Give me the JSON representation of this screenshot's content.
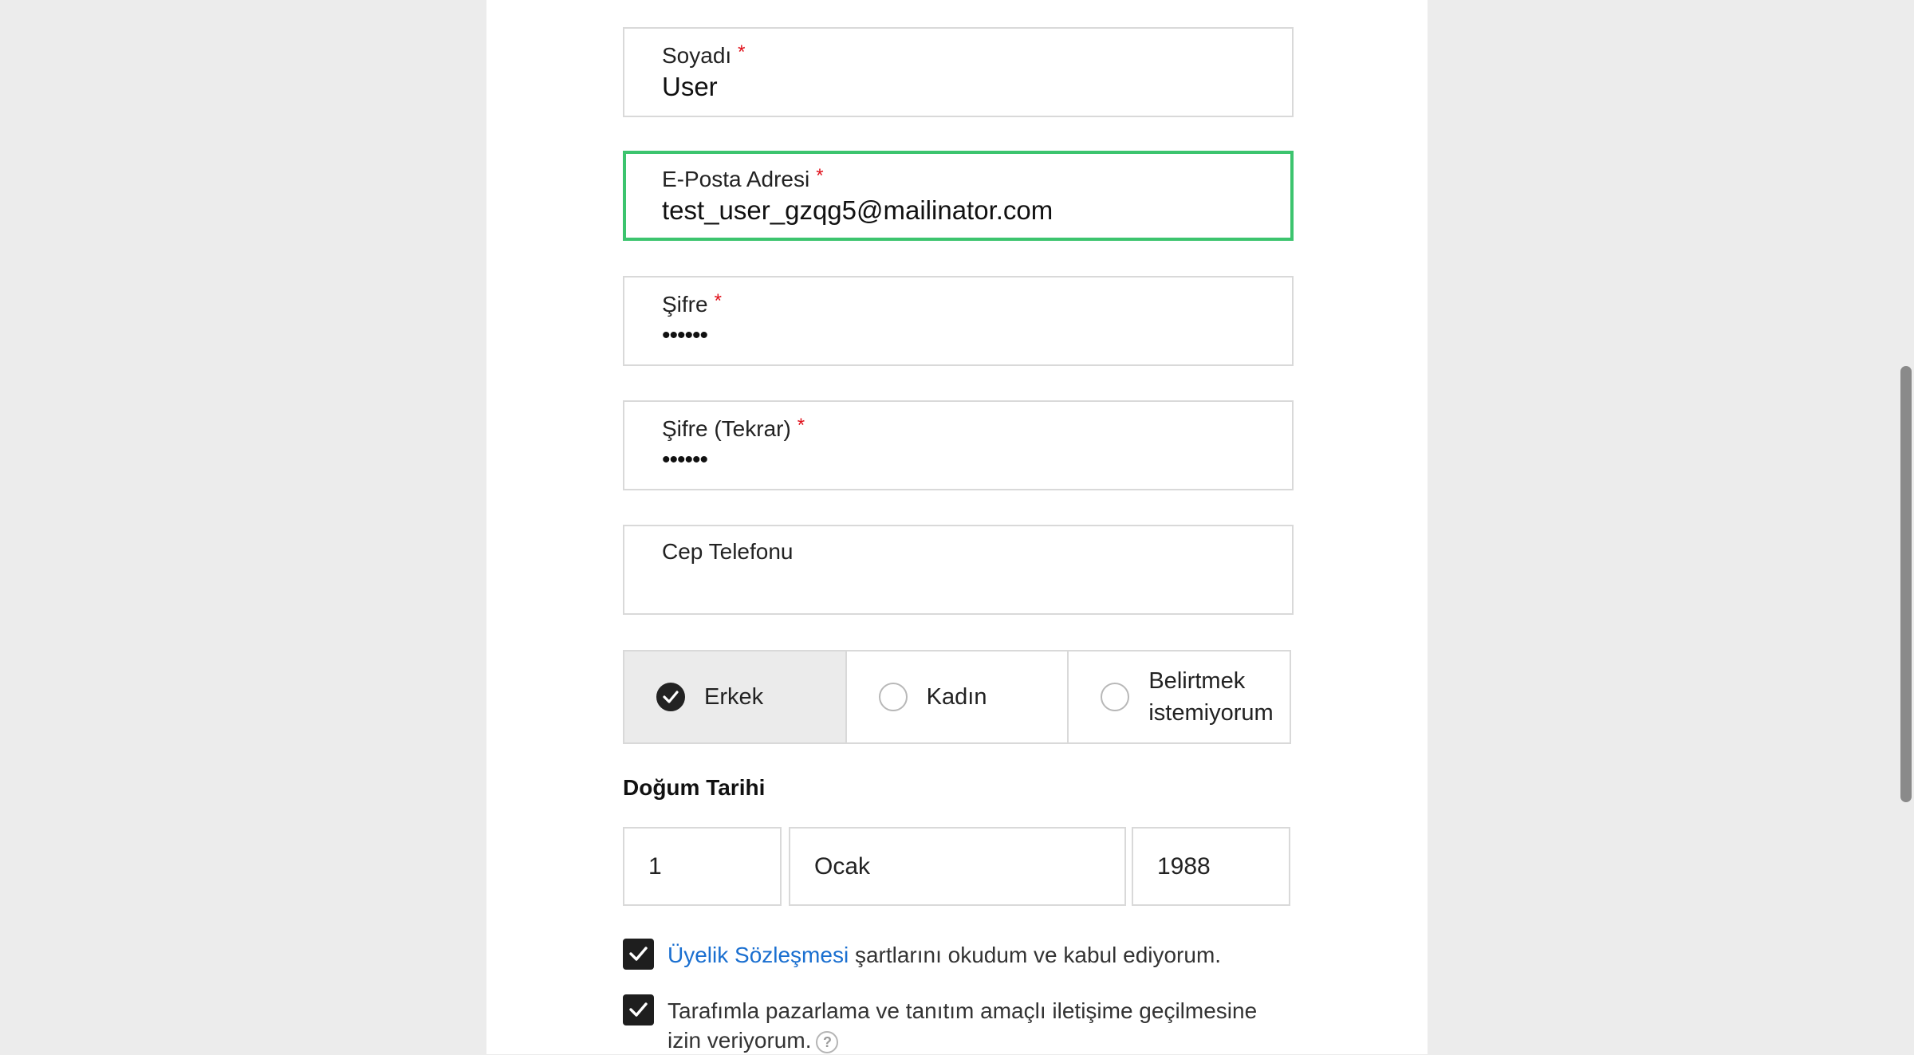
{
  "form": {
    "surname": {
      "label": "Soyadı",
      "required_mark": "*",
      "value": "User"
    },
    "email": {
      "label": "E-Posta Adresi",
      "required_mark": "*",
      "value": "test_user_gzqg5@mailinator.com"
    },
    "password": {
      "label": "Şifre",
      "required_mark": "*",
      "value": "••••••"
    },
    "password_repeat": {
      "label": "Şifre (Tekrar)",
      "required_mark": "*",
      "value": "••••••"
    },
    "phone": {
      "label": "Cep Telefonu",
      "value": ""
    },
    "gender": {
      "selected": "Erkek",
      "options": [
        {
          "label": "Erkek",
          "checked": true
        },
        {
          "label": "Kadın",
          "checked": false
        },
        {
          "label": "Belirtmek istemiyorum",
          "checked": false
        }
      ]
    },
    "birth_date": {
      "title": "Doğum Tarihi",
      "day": "1",
      "month": "Ocak",
      "year": "1988"
    },
    "agreements": {
      "membership": {
        "checked": true,
        "link_text": "Üyelik Sözleşmesi",
        "text": " şartlarını okudum ve kabul ediyorum."
      },
      "marketing": {
        "checked": true,
        "line1": "Tarafımla pazarlama ve tanıtım amaçlı iletişime geçilmesine",
        "line2": "izin veriyorum.",
        "help_icon": "question-circle-icon",
        "help_glyph": "?"
      }
    }
  },
  "colors": {
    "focus_border": "#3cc46e",
    "required": "#e0101a",
    "link": "#1a6fd0",
    "checkbox_fill": "#1e1e1e"
  }
}
